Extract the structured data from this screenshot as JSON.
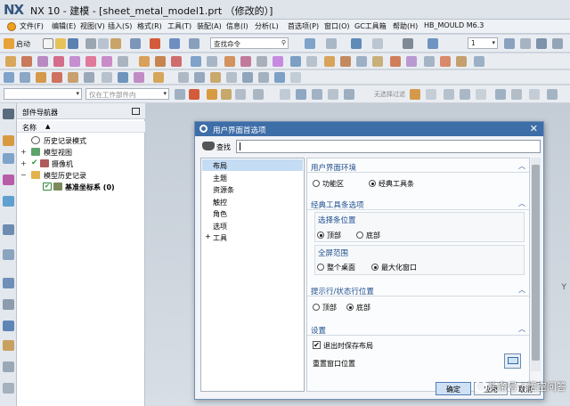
{
  "app": {
    "logo": "NX",
    "title": "NX 10 - 建模 - [sheet_metal_model1.prt （修改的）]"
  },
  "menubar": {
    "items": [
      "文件(F)",
      "编辑(E)",
      "视图(V)",
      "插入(S)",
      "格式(R)",
      "工具(T)",
      "装配(A)",
      "信息(I)",
      "分析(L)",
      "首选项(P)",
      "窗口(O)",
      "GC工具箱",
      "帮助(H)",
      "HB_MOULD M6.3"
    ]
  },
  "toolbar1": {
    "start_label": "启动",
    "command_search": "查找命令",
    "layer_value": "1"
  },
  "toolbar3": {
    "filter_placeholder": "仅在工作部件内",
    "snap_label": "无选择过滤"
  },
  "navigator": {
    "title": "部件导航器",
    "column_name": "名称",
    "items": [
      {
        "label": "历史记录模式",
        "icon": "history-icon"
      },
      {
        "label": "模型视图",
        "icon": "model-view-icon"
      },
      {
        "label": "摄像机",
        "icon": "camera-icon"
      },
      {
        "label": "模型历史记录",
        "icon": "folder-icon"
      },
      {
        "label": "基准坐标系 (0)",
        "icon": "datum-csys-icon"
      }
    ]
  },
  "graphics": {
    "axis_label": "Y"
  },
  "dialog": {
    "title": "用户界面首选项",
    "find_label": "查找",
    "find_value": "",
    "categories": [
      "布局",
      "主题",
      "资源条",
      "触控",
      "角色",
      "选项",
      "工具"
    ],
    "selected_category": "布局",
    "groups": {
      "ui_env": {
        "title": "用户界面环境",
        "options": [
          "功能区",
          "经典工具条"
        ],
        "selected": "经典工具条"
      },
      "classic_toolbar": {
        "title": "经典工具条选项",
        "position": {
          "title": "选择条位置",
          "options": [
            "顶部",
            "底部"
          ],
          "selected": "顶部"
        },
        "fullscreen": {
          "title": "全屏范围",
          "options": [
            "整个桌面",
            "最大化窗口"
          ],
          "selected": "最大化窗口"
        }
      },
      "prompt_status": {
        "title": "提示行/状态行位置",
        "options": [
          "顶部",
          "底部"
        ],
        "selected": "底部"
      },
      "settings": {
        "title": "设置",
        "save_on_exit_label": "退出时保存布局",
        "save_on_exit_checked": true,
        "reset_label": "重置窗口位置"
      }
    },
    "buttons": {
      "ok": "确定",
      "apply": "应用",
      "cancel": "取消"
    }
  },
  "watermark": "头条号 / 悟空问答"
}
